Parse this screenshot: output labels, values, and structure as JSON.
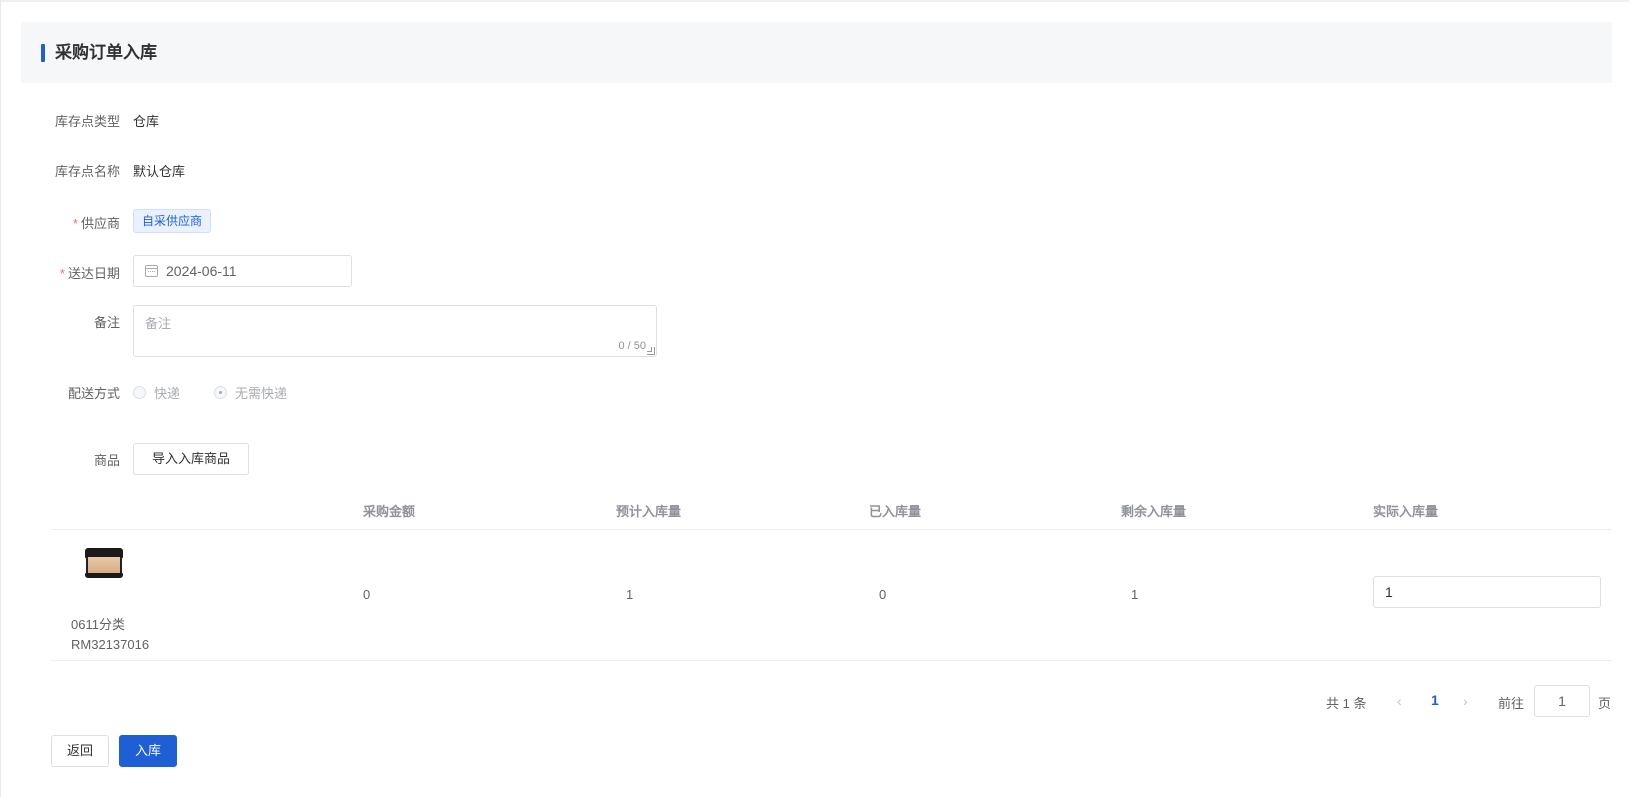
{
  "header": {
    "title": "采购订单入库"
  },
  "form": {
    "stock_point_type": {
      "label": "库存点类型",
      "value": "仓库"
    },
    "stock_point_name": {
      "label": "库存点名称",
      "value": "默认仓库"
    },
    "supplier": {
      "required_mark": "*",
      "label": "供应商",
      "tag": "自采供应商"
    },
    "delivery_date": {
      "required_mark": "*",
      "label": "送达日期",
      "value": "2024-06-11"
    },
    "remark": {
      "label": "备注",
      "placeholder": "备注",
      "counter": "0 / 50"
    },
    "delivery_method": {
      "label": "配送方式",
      "options": [
        {
          "label": "快递",
          "checked": false
        },
        {
          "label": "无需快递",
          "checked": true
        }
      ]
    },
    "products": {
      "label": "商品",
      "import_button": "导入入库商品"
    }
  },
  "table": {
    "columns": [
      "采购金额",
      "预计入库量",
      "已入库量",
      "剩余入库量",
      "实际入库量"
    ],
    "rows": [
      {
        "product_name": "0611分类",
        "product_code": "RM32137016",
        "purchase_amount": "0",
        "expected_qty": "1",
        "received_qty": "0",
        "remaining_qty": "1",
        "actual_qty": "1"
      }
    ]
  },
  "pagination": {
    "total": "共 1 条",
    "prev": "‹",
    "current": "1",
    "next": "›",
    "goto_label": "前往",
    "goto_value": "1",
    "page_suffix": "页"
  },
  "actions": {
    "back": "返回",
    "submit": "入库"
  },
  "colors": {
    "primary": "#1f5fd6",
    "required": "#f56c6c",
    "header_bg": "#f6f7f9"
  }
}
